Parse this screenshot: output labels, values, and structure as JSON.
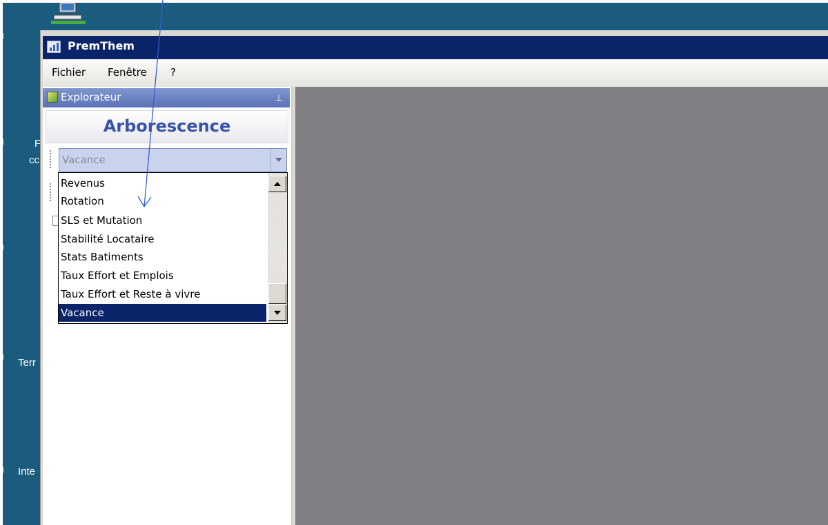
{
  "desktop": {
    "fragments": [
      "F",
      "cc",
      "Terr",
      "Inte"
    ]
  },
  "window": {
    "title": "PremThem"
  },
  "menu": {
    "fichier": "Fichier",
    "fenetre": "Fenêtre",
    "help": "?"
  },
  "explorer": {
    "title": "Explorateur",
    "panel_title": "Arborescence",
    "combo_value": "Vacance",
    "list_items": [
      "Revenus",
      "Rotation",
      "SLS et Mutation",
      "Stabilité Locataire",
      "Stats Batiments",
      "Taux Effort et Emplois",
      "Taux Effort et Reste à vivre",
      "Vacance"
    ],
    "selected_item": "Vacance"
  },
  "colors": {
    "desktop": "#1b5c7e",
    "titlebar": "#0a246a",
    "selection": "#0a246a",
    "mdi_background": "#817f83",
    "panel_title": "#3753a8",
    "annotation_arrow": "#3060c8"
  },
  "icons": {
    "app": "app-chart-icon",
    "explorer": "explorer-book-icon",
    "pin": "pin-icon",
    "network": "network-computer-icon"
  }
}
